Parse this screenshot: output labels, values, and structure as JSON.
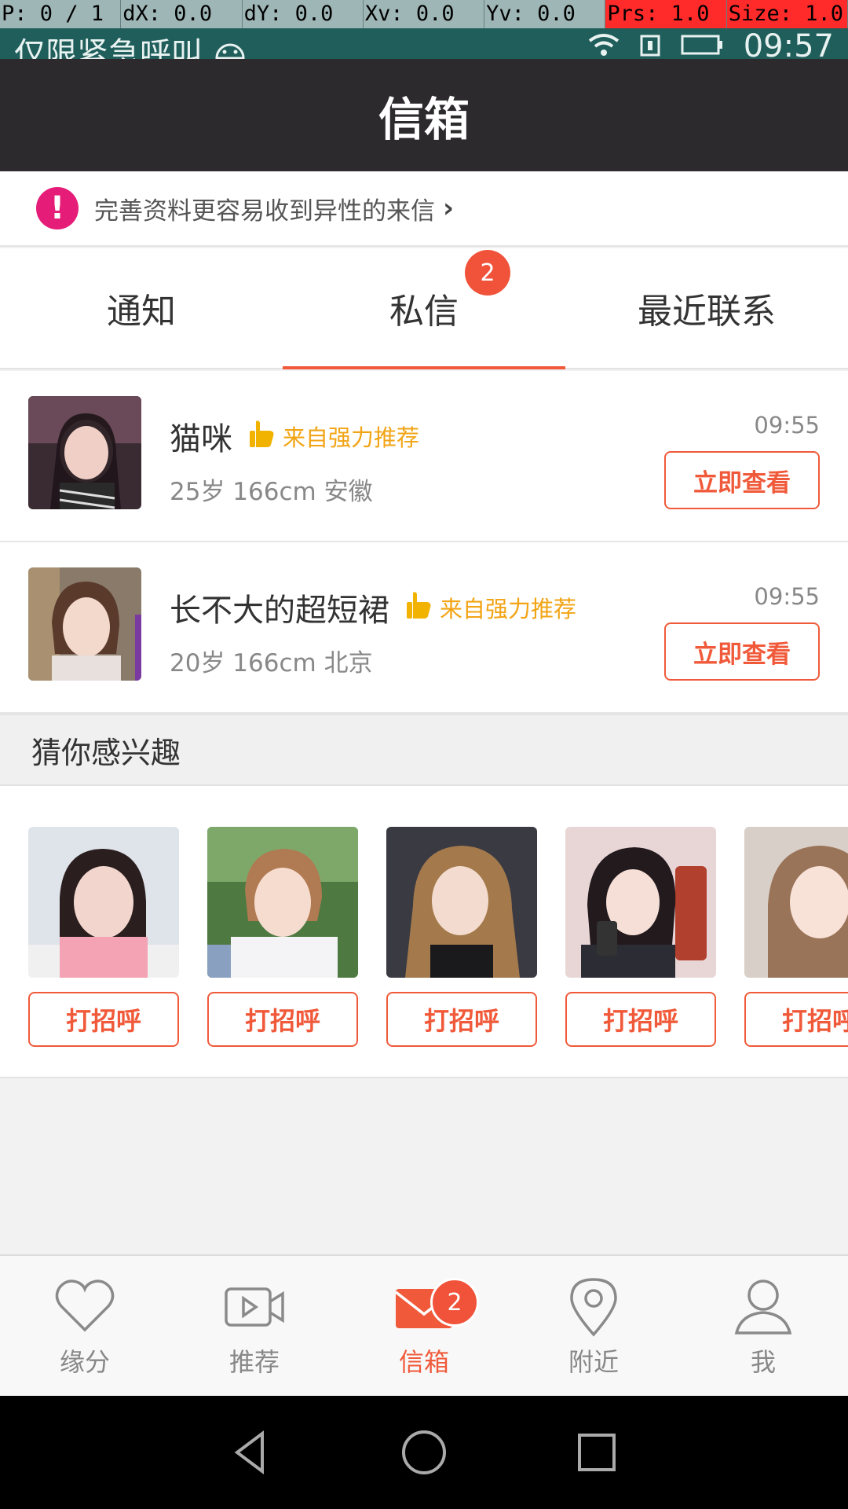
{
  "debug": {
    "p": "P: 0 / 1",
    "dx": "dX: 0.0",
    "dy": "dY: 0.0",
    "xv": "Xv: 0.0",
    "yv": "Yv: 0.0",
    "prs": "Prs: 1.0",
    "size": "Size: 1.0"
  },
  "status": {
    "carrier": "仅限紧急呼叫",
    "time": "09:57"
  },
  "title": "信箱",
  "notice": {
    "text": "完善资料更容易收到异性的来信",
    "icon": "exclamation-icon"
  },
  "tabs": [
    {
      "label": "通知"
    },
    {
      "label": "私信",
      "badge": "2"
    },
    {
      "label": "最近联系"
    }
  ],
  "messages": [
    {
      "name": "猫咪",
      "tag": "来自强力推荐",
      "meta": "25岁  166cm  安徽",
      "time": "09:55",
      "action": "立即查看"
    },
    {
      "name": "长不大的超短裙",
      "tag": "来自强力推荐",
      "meta": "20岁  166cm  北京",
      "time": "09:55",
      "action": "立即查看"
    }
  ],
  "interest": {
    "title": "猜你感兴趣",
    "cards": [
      {
        "action": "打招呼"
      },
      {
        "action": "打招呼"
      },
      {
        "action": "打招呼"
      },
      {
        "action": "打招呼"
      },
      {
        "action": "打招呼"
      }
    ]
  },
  "bottom_nav": [
    {
      "label": "缘分",
      "icon": "heart-icon"
    },
    {
      "label": "推荐",
      "icon": "video-icon"
    },
    {
      "label": "信箱",
      "icon": "mail-icon",
      "badge": "2"
    },
    {
      "label": "附近",
      "icon": "location-pin-icon"
    },
    {
      "label": "我",
      "icon": "person-icon"
    }
  ],
  "colors": {
    "accent": "#f05a3a",
    "title_bar": "#2d2a2d",
    "status_bar": "#1f5e5b",
    "recommend": "#f2a415"
  }
}
